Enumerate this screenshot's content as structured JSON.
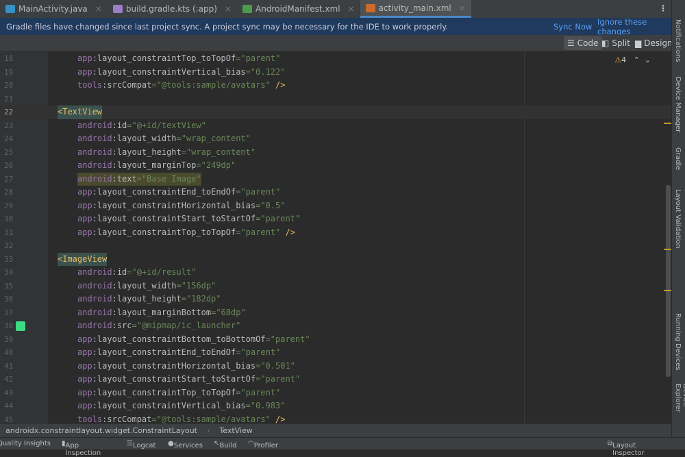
{
  "tabs": [
    {
      "label": "MainActivity.java",
      "color": "#3592c4"
    },
    {
      "label": "build.gradle.kts (:app)",
      "color": "#9c7ec8"
    },
    {
      "label": "AndroidManifest.xml",
      "color": "#4c9b4c"
    },
    {
      "label": "activity_main.xml",
      "color": "#cc6b2c",
      "active": true
    }
  ],
  "banner": {
    "message": "Gradle files have changed since last project sync. A project sync may be necessary for the IDE to work properly.",
    "sync_now": "Sync Now",
    "ignore": "Ignore these changes"
  },
  "view_modes": {
    "code": "Code",
    "split": "Split",
    "design": "Design"
  },
  "warnings": "4",
  "lines": [
    {
      "n": "18",
      "tokens": [
        [
          "ns",
          "app"
        ],
        [
          "pl",
          ":"
        ],
        [
          "at",
          "layout_constraintTop_toTopOf"
        ],
        [
          "val",
          "=\"parent\""
        ]
      ]
    },
    {
      "n": "19",
      "tokens": [
        [
          "ns",
          "app"
        ],
        [
          "pl",
          ":"
        ],
        [
          "at",
          "layout_constraintVertical_bias"
        ],
        [
          "val",
          "=\"0.122\""
        ]
      ]
    },
    {
      "n": "20",
      "tokens": [
        [
          "ns",
          "tools"
        ],
        [
          "pl",
          ":"
        ],
        [
          "at",
          "srcCompat"
        ],
        [
          "val",
          "=\"@tools:sample/avatars\""
        ],
        [
          "tag",
          " />"
        ]
      ]
    },
    {
      "n": "21",
      "tokens": []
    },
    {
      "n": "22",
      "tag": true,
      "tokens": [
        [
          "tag",
          "<TextView"
        ]
      ]
    },
    {
      "n": "23",
      "tokens": [
        [
          "ns",
          "android"
        ],
        [
          "pl",
          ":"
        ],
        [
          "at",
          "id"
        ],
        [
          "val",
          "=\"@+id/textView\""
        ]
      ]
    },
    {
      "n": "24",
      "tokens": [
        [
          "ns",
          "android"
        ],
        [
          "pl",
          ":"
        ],
        [
          "at",
          "layout_width"
        ],
        [
          "val",
          "=\"wrap_content\""
        ]
      ]
    },
    {
      "n": "25",
      "tokens": [
        [
          "ns",
          "android"
        ],
        [
          "pl",
          ":"
        ],
        [
          "at",
          "layout_height"
        ],
        [
          "val",
          "=\"wrap_content\""
        ]
      ]
    },
    {
      "n": "26",
      "tokens": [
        [
          "ns",
          "android"
        ],
        [
          "pl",
          ":"
        ],
        [
          "at",
          "layout_marginTop"
        ],
        [
          "val",
          "=\"249dp\""
        ]
      ]
    },
    {
      "n": "27",
      "hl": true,
      "tokens": [
        [
          "ns",
          "android"
        ],
        [
          "pl",
          ":"
        ],
        [
          "at",
          "text"
        ],
        [
          "val",
          "=\"Base Image\""
        ]
      ]
    },
    {
      "n": "28",
      "tokens": [
        [
          "ns",
          "app"
        ],
        [
          "pl",
          ":"
        ],
        [
          "at",
          "layout_constraintEnd_toEndOf"
        ],
        [
          "val",
          "=\"parent\""
        ]
      ]
    },
    {
      "n": "29",
      "tokens": [
        [
          "ns",
          "app"
        ],
        [
          "pl",
          ":"
        ],
        [
          "at",
          "layout_constraintHorizontal_bias"
        ],
        [
          "val",
          "=\"0.5\""
        ]
      ]
    },
    {
      "n": "30",
      "tokens": [
        [
          "ns",
          "app"
        ],
        [
          "pl",
          ":"
        ],
        [
          "at",
          "layout_constraintStart_toStartOf"
        ],
        [
          "val",
          "=\"parent\""
        ]
      ]
    },
    {
      "n": "31",
      "tokens": [
        [
          "ns",
          "app"
        ],
        [
          "pl",
          ":"
        ],
        [
          "at",
          "layout_constraintTop_toTopOf"
        ],
        [
          "val",
          "=\"parent\""
        ],
        [
          "tag",
          " />"
        ]
      ]
    },
    {
      "n": "32",
      "tokens": []
    },
    {
      "n": "33",
      "tag": true,
      "tokens": [
        [
          "tag",
          "<ImageView"
        ]
      ]
    },
    {
      "n": "34",
      "tokens": [
        [
          "ns",
          "android"
        ],
        [
          "pl",
          ":"
        ],
        [
          "at",
          "id"
        ],
        [
          "val",
          "=\"@+id/result\""
        ]
      ]
    },
    {
      "n": "35",
      "tokens": [
        [
          "ns",
          "android"
        ],
        [
          "pl",
          ":"
        ],
        [
          "at",
          "layout_width"
        ],
        [
          "val",
          "=\"156dp\""
        ]
      ]
    },
    {
      "n": "36",
      "tokens": [
        [
          "ns",
          "android"
        ],
        [
          "pl",
          ":"
        ],
        [
          "at",
          "layout_height"
        ],
        [
          "val",
          "=\"182dp\""
        ]
      ]
    },
    {
      "n": "37",
      "tokens": [
        [
          "ns",
          "android"
        ],
        [
          "pl",
          ":"
        ],
        [
          "at",
          "layout_marginBottom"
        ],
        [
          "val",
          "=\"68dp\""
        ]
      ]
    },
    {
      "n": "38",
      "tokens": [
        [
          "ns",
          "android"
        ],
        [
          "pl",
          ":"
        ],
        [
          "at",
          "src"
        ],
        [
          "val",
          "=\"@mipmap/ic_launcher\""
        ]
      ]
    },
    {
      "n": "39",
      "tokens": [
        [
          "ns",
          "app"
        ],
        [
          "pl",
          ":"
        ],
        [
          "at",
          "layout_constraintBottom_toBottomOf"
        ],
        [
          "val",
          "=\"parent\""
        ]
      ]
    },
    {
      "n": "40",
      "tokens": [
        [
          "ns",
          "app"
        ],
        [
          "pl",
          ":"
        ],
        [
          "at",
          "layout_constraintEnd_toEndOf"
        ],
        [
          "val",
          "=\"parent\""
        ]
      ]
    },
    {
      "n": "41",
      "tokens": [
        [
          "ns",
          "app"
        ],
        [
          "pl",
          ":"
        ],
        [
          "at",
          "layout_constraintHorizontal_bias"
        ],
        [
          "val",
          "=\"0.501\""
        ]
      ]
    },
    {
      "n": "42",
      "tokens": [
        [
          "ns",
          "app"
        ],
        [
          "pl",
          ":"
        ],
        [
          "at",
          "layout_constraintStart_toStartOf"
        ],
        [
          "val",
          "=\"parent\""
        ]
      ]
    },
    {
      "n": "43",
      "tokens": [
        [
          "ns",
          "app"
        ],
        [
          "pl",
          ":"
        ],
        [
          "at",
          "layout_constraintTop_toTopOf"
        ],
        [
          "val",
          "=\"parent\""
        ]
      ]
    },
    {
      "n": "44",
      "tokens": [
        [
          "ns",
          "app"
        ],
        [
          "pl",
          ":"
        ],
        [
          "at",
          "layout_constraintVertical_bias"
        ],
        [
          "val",
          "=\"0.983\""
        ]
      ]
    },
    {
      "n": "45",
      "tokens": [
        [
          "ns",
          "tools"
        ],
        [
          "pl",
          ":"
        ],
        [
          "at",
          "srcCompat"
        ],
        [
          "val",
          "=\"@tools:sample/avatars\""
        ],
        [
          "tag",
          " />"
        ]
      ]
    }
  ],
  "breadcrumb": [
    "androidx.constraintlayout.widget.ConstraintLayout",
    "TextView"
  ],
  "bottom_tools": {
    "quality": "Quality Insights",
    "app_inspection": "App Inspection",
    "logcat": "Logcat",
    "services": "Services",
    "build": "Build",
    "profiler": "Profiler",
    "layout_inspector": "Layout Inspector"
  },
  "right_tools": {
    "notifications": "Notifications",
    "device_manager": "Device Manager",
    "gradle": "Gradle",
    "layout_validation": "Layout Validation",
    "running_devices": "Running Devices",
    "device_explorer": "Device Explorer"
  }
}
